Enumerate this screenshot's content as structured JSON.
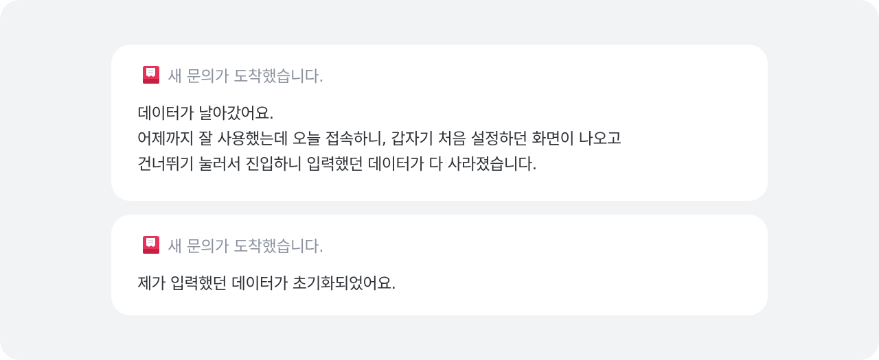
{
  "notifications": [
    {
      "icon": "receipt-icon",
      "header": "새 문의가 도착했습니다.",
      "lines": [
        "데이터가 날아갔어요.",
        "어제까지 잘 사용했는데 오늘 접속하니, 갑자기 처음 설정하던 화면이 나오고",
        "건너뛰기 눌러서 진입하니 입력했던 데이터가 다 사라졌습니다."
      ]
    },
    {
      "icon": "receipt-icon",
      "header": "새 문의가 도착했습니다.",
      "lines": [
        "제가 입력했던 데이터가 초기화되었어요."
      ]
    }
  ],
  "colors": {
    "background": "#f2f3f5",
    "card": "#ffffff",
    "header_text": "#8b929e",
    "body_text": "#2e3136",
    "icon_accent": "#e8325a"
  }
}
